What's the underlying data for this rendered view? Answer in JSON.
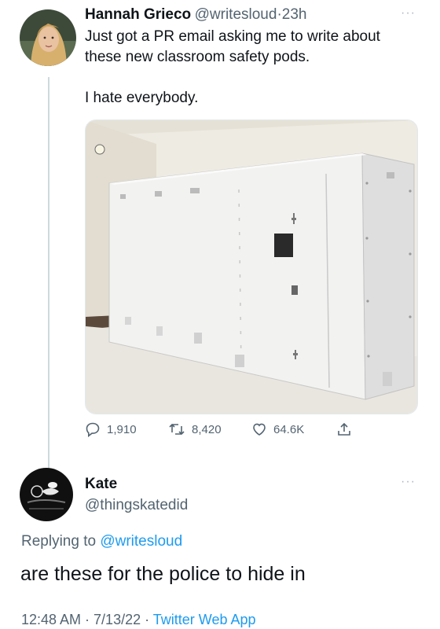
{
  "tweet": {
    "author_name": "Hannah Grieco",
    "author_handle": "@writesloud",
    "separator": "·",
    "time": "23h",
    "more": "···",
    "text_line1": "Just got a PR email asking me to write about",
    "text_line2": "these new classroom safety pods.",
    "text_line3": "I hate everybody.",
    "media_icon": "safety-pod-photo",
    "stats": {
      "replies": "1,910",
      "retweets": "8,420",
      "likes": "64.6K"
    },
    "icons": {
      "reply": "speech-bubble-icon",
      "retweet": "retweet-icon",
      "like": "heart-icon",
      "share": "share-icon"
    }
  },
  "reply": {
    "author_name": "Kate",
    "author_handle": "@thingskatedid",
    "more": "···",
    "replying_prefix": "Replying to",
    "replying_handle": "@writesloud",
    "text": "are these for the police to hide in",
    "meta_time": "12:48 AM · 7/13/22 ·",
    "meta_app": "Twitter Web App"
  },
  "colors": {
    "link": "#1d9bf0",
    "muted": "#536471",
    "text": "#0f1419"
  }
}
